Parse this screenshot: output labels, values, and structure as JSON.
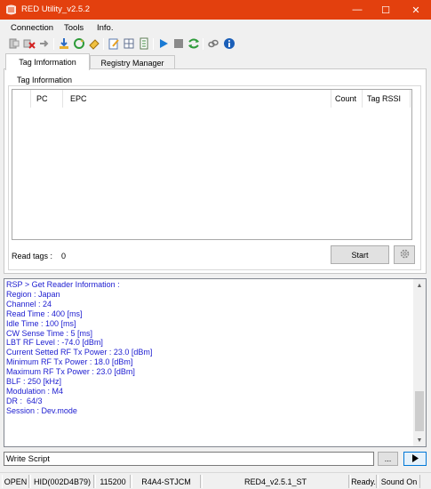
{
  "window": {
    "title": "RED Utility_v2.5.2",
    "controls": {
      "minimize": "—",
      "maximize": "☐",
      "close": "✕"
    }
  },
  "menubar": {
    "items": [
      "Connection",
      "Tools",
      "Info."
    ]
  },
  "toolbar": {
    "icons": [
      "connect-icon",
      "disconnect-icon",
      "reconnect-icon",
      "download-icon",
      "refresh-icon",
      "eraser-icon",
      "edit-icon",
      "grid-icon",
      "document-icon",
      "play-icon",
      "stop-icon",
      "cycle-icon",
      "link-icon",
      "info-icon"
    ]
  },
  "tabs": [
    {
      "label": "Tag Imformation",
      "active": true
    },
    {
      "label": "Registry Manager",
      "active": false
    }
  ],
  "tag_info": {
    "group_title": "Tag Information",
    "columns": [
      "",
      "PC",
      "EPC",
      "Count",
      "Tag RSSI"
    ],
    "rows": [],
    "read_tags_label": "Read tags :",
    "read_tags_count": "0",
    "start_button": "Start"
  },
  "log": {
    "lines": [
      "RSP > Get Reader Information :",
      "Region : Japan",
      "Channel : 24",
      "Read Time : 400 [ms]",
      "Idle Time : 100 [ms]",
      "CW Sense Time : 5 [ms]",
      "LBT RF Level : -74.0 [dBm]",
      "Current Setted RF Tx Power : 23.0 [dBm]",
      "Minimum RF Tx Power : 18.0 [dBm]",
      "Maximum RF Tx Power : 23.0 [dBm]",
      "BLF : 250 [kHz]",
      "Modulation : M4",
      "DR :  64/3",
      "Session : Dev.mode"
    ],
    "colors": {
      "text": "#1c1cd0"
    }
  },
  "script": {
    "input_value": "Write Script",
    "browse_button": "...",
    "run_icon": "play-arrow-icon"
  },
  "statusbar": {
    "cells": [
      "OPEN",
      "HID(002D4B79)",
      "115200",
      "R4A4-STJCM",
      "RED4_v2.5.1_ST",
      "Ready.",
      "Sound On"
    ]
  },
  "colors": {
    "titlebar": "#e3400e",
    "accent": "#1a7ad4"
  }
}
